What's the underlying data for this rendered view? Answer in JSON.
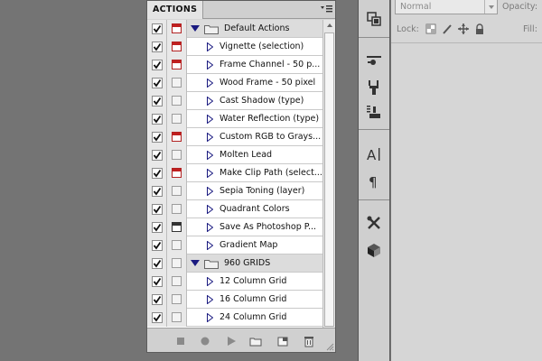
{
  "actions_panel": {
    "tab_label": "ACTIONS",
    "menu_icon": "panel-menu-icon",
    "groups": [
      {
        "name": "Default Actions",
        "checked": true,
        "dialog": "on",
        "expanded": true,
        "items": [
          {
            "label": "Vignette (selection)",
            "checked": true,
            "dialog": "on"
          },
          {
            "label": "Frame Channel - 50 p...",
            "checked": true,
            "dialog": "on"
          },
          {
            "label": "Wood Frame - 50 pixel",
            "checked": true,
            "dialog": "none"
          },
          {
            "label": "Cast Shadow (type)",
            "checked": true,
            "dialog": "none"
          },
          {
            "label": "Water Reflection (type)",
            "checked": true,
            "dialog": "none"
          },
          {
            "label": "Custom RGB to Grays...",
            "checked": true,
            "dialog": "on"
          },
          {
            "label": "Molten Lead",
            "checked": true,
            "dialog": "none"
          },
          {
            "label": "Make Clip Path (select...",
            "checked": true,
            "dialog": "on"
          },
          {
            "label": "Sepia Toning (layer)",
            "checked": true,
            "dialog": "none"
          },
          {
            "label": "Quadrant Colors",
            "checked": true,
            "dialog": "none"
          },
          {
            "label": "Save As Photoshop P...",
            "checked": true,
            "dialog": "dark"
          },
          {
            "label": "Gradient Map",
            "checked": true,
            "dialog": "none"
          }
        ]
      },
      {
        "name": "960 GRIDS",
        "checked": true,
        "dialog": "none",
        "expanded": true,
        "items": [
          {
            "label": "12 Column Grid",
            "checked": true,
            "dialog": "none"
          },
          {
            "label": "16 Column Grid",
            "checked": true,
            "dialog": "none"
          },
          {
            "label": "24 Column Grid",
            "checked": true,
            "dialog": "none"
          }
        ]
      }
    ],
    "footer_buttons": [
      "stop-icon",
      "record-icon",
      "play-icon",
      "new-set-icon",
      "new-action-icon",
      "trash-icon"
    ]
  },
  "toolbar": {
    "tools": [
      "layer-comps-icon",
      "brush-presets-icon",
      "clone-source-icon",
      "tool-presets-icon",
      "character-icon",
      "paragraph-icon",
      "tools-icon",
      "3d-icon"
    ]
  },
  "layers_panel": {
    "blend_mode": "Normal",
    "opacity_label": "Opacity:",
    "lock_label": "Lock:",
    "fill_label": "Fill:"
  },
  "colors": {
    "workspace": "#747474",
    "panel": "#d6d6d6",
    "dialog_red": "#c02020"
  }
}
